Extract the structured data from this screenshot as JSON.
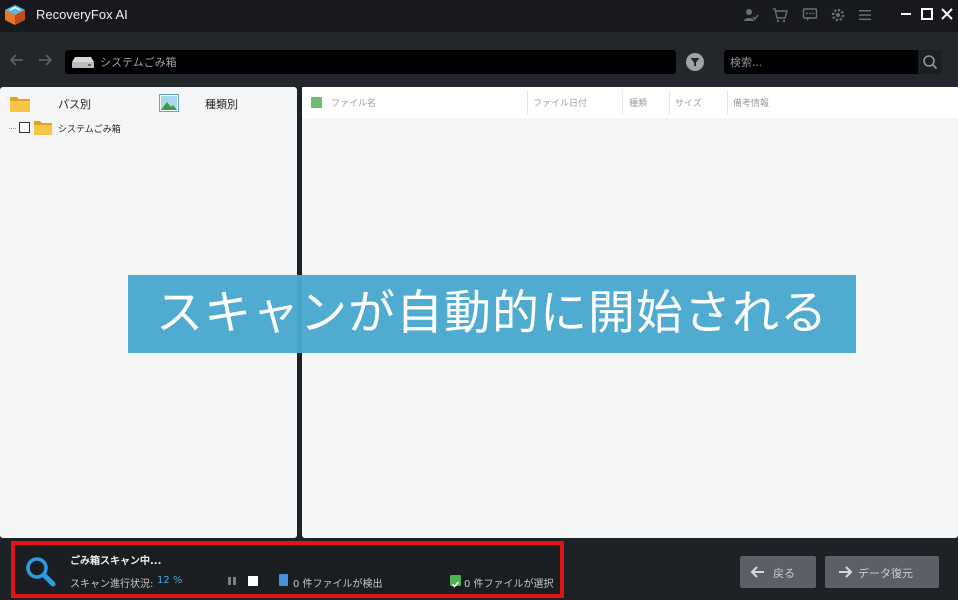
{
  "window": {
    "title": "RecoveryFox AI",
    "icons": [
      "user-check-icon",
      "cart-icon",
      "chat-icon",
      "gear-icon",
      "menu-icon"
    ],
    "controls": {
      "minimize": "—",
      "maximize": "☐",
      "close": "✕"
    }
  },
  "nav": {
    "back_icon": "arrow-left-icon",
    "forward_icon": "arrow-right-icon",
    "path": "システムごみ箱",
    "search_placeholder": "検索..."
  },
  "left_panel": {
    "tabs": [
      {
        "label": "パス別",
        "icon": "folder-icon"
      },
      {
        "label": "種類別",
        "icon": "image-icon"
      }
    ],
    "tree": [
      {
        "label": "システムごみ箱",
        "checked": false
      }
    ]
  },
  "table": {
    "columns": [
      "ファイル名",
      "ファイル日付",
      "種類",
      "サイズ",
      "備考情報"
    ],
    "rows": []
  },
  "banner": {
    "text": "スキャンが自動的に開始される"
  },
  "status": {
    "title": "ごみ箱スキャン中...",
    "progress_label": "スキャン進行状況:",
    "progress_value": "12 %",
    "progress_fraction": 0.12,
    "found_text": "0 件ファイルが検出",
    "selected_text": "0 件ファイルが選択"
  },
  "buttons": {
    "back": "戻る",
    "restore": "データ復元"
  },
  "colors": {
    "highlight_border": "#e0131b",
    "accent_blue": "#3fa9e0",
    "banner_bg": "#4aa8d0"
  }
}
